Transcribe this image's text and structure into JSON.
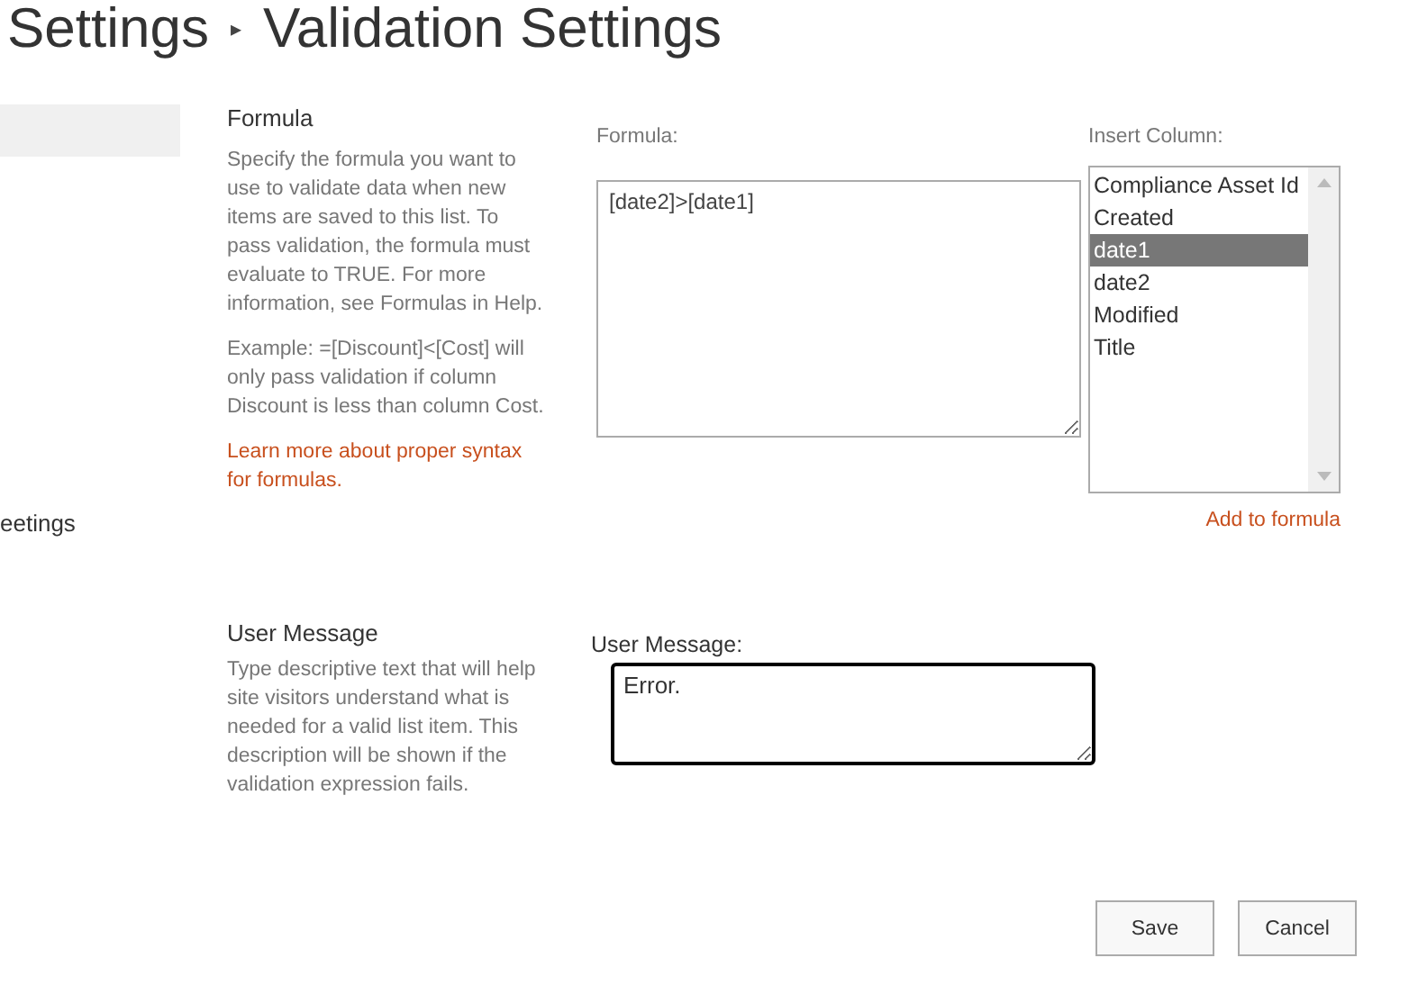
{
  "breadcrumb": {
    "parent": "Settings",
    "separator": "▸",
    "current": "Validation Settings"
  },
  "nav": {
    "highlight": true,
    "items": [
      {
        "label": "eetings"
      }
    ]
  },
  "formula_section": {
    "heading": "Formula",
    "description": "Specify the formula you want to use to validate data when new items are saved to this list. To pass validation, the formula must evaluate to TRUE. For more information, see Formulas in Help.",
    "example": "Example: =[Discount]<[Cost] will only pass validation if column Discount is less than column Cost.",
    "link": "Learn more about proper syntax for formulas.",
    "field_label": "Formula:",
    "value": "[date2]>[date1]",
    "insert_label": "Insert Column:",
    "columns": [
      {
        "label": "Compliance Asset Id",
        "selected": false
      },
      {
        "label": "Created",
        "selected": false
      },
      {
        "label": "date1",
        "selected": true
      },
      {
        "label": "date2",
        "selected": false
      },
      {
        "label": "Modified",
        "selected": false
      },
      {
        "label": "Title",
        "selected": false
      }
    ],
    "add_link": "Add to formula"
  },
  "message_section": {
    "heading": "User Message",
    "description": "Type descriptive text that will help site visitors understand what is needed for a valid list item. This description will be shown if the validation expression fails.",
    "field_label": "User Message:",
    "value": "Error.",
    "focused": true
  },
  "buttons": [
    {
      "label": "Save"
    },
    {
      "label": "Cancel"
    }
  ]
}
